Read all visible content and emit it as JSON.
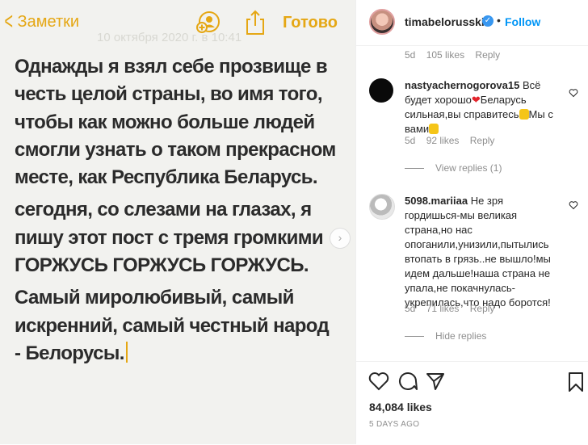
{
  "notes": {
    "back_label": "Заметки",
    "done_label": "Готово",
    "faded_date": "10 октября 2020 г. в 10:41",
    "paragraphs": [
      "Однажды я взял себе прозвище в честь целой страны, во имя того, чтобы как можно больше людей смогли узнать о таком прекрасном месте, как Республика Беларусь.",
      "сегодня, со слезами на глазах, я пишу этот пост с тремя громкими ГОРЖУСЬ ГОРЖУСЬ ГОРЖУСЬ.",
      "Самый миролюбивый, самый искренний, самый честный народ - Белорусы."
    ],
    "next_glyph": "›"
  },
  "post": {
    "username": "timabelorusskih",
    "verified_glyph": "✓",
    "dot": "•",
    "follow_label": "Follow",
    "likes": "84,084 likes",
    "time_ago": "5 DAYS AGO"
  },
  "comments": {
    "top_meta": {
      "age": "5d",
      "likes": "105 likes",
      "reply": "Reply"
    },
    "items": [
      {
        "username": "nastyachernogorova15",
        "text_a": "Всё будет хорошо",
        "text_b": "Беларусь сильная,вы справитесь",
        "text_c": "Мы с вами",
        "heart_emoji": "❤",
        "age": "5d",
        "likes": "92 likes",
        "reply": "Reply",
        "replies_label": "View replies (1)"
      },
      {
        "username": "5098.mariiaa",
        "text": "Не зря гордишься-мы великая страна,но нас опоганили,унизили,пытылись втопать в грязь..не вышло!мы идем дальше!наша страна не упала,не покачнулась-укрепилась,что надо боротся!",
        "age": "5d",
        "likes": "71 likes",
        "reply": "Reply",
        "replies_label": "Hide replies"
      }
    ]
  },
  "colors": {
    "accent": "#e5a714",
    "link": "#0095f6"
  }
}
